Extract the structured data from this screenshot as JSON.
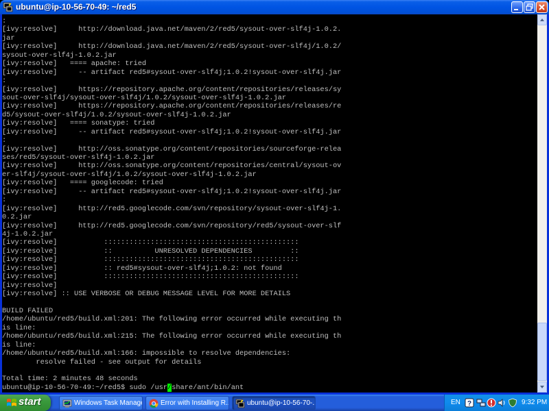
{
  "window": {
    "title": "ubuntu@ip-10-56-70-49: ~/red5",
    "controls": {
      "minimize": "minimize",
      "maximize": "maximize",
      "close": "close"
    }
  },
  "terminal": {
    "lines": [
      ":",
      "[ivy:resolve]     http://download.java.net/maven/2/red5/sysout-over-slf4j-1.0.2.",
      "jar",
      "[ivy:resolve]     http://download.java.net/maven/2/red5/sysout-over-slf4j/1.0.2/",
      "sysout-over-slf4j-1.0.2.jar",
      "[ivy:resolve]   ==== apache: tried",
      "[ivy:resolve]     -- artifact red5#sysout-over-slf4j;1.0.2!sysout-over-slf4j.jar",
      ":",
      "[ivy:resolve]     https://repository.apache.org/content/repositories/releases/sy",
      "sout-over-slf4j/sysout-over-slf4j/1.0.2/sysout-over-slf4j-1.0.2.jar",
      "[ivy:resolve]     https://repository.apache.org/content/repositories/releases/re",
      "d5/sysout-over-slf4j/1.0.2/sysout-over-slf4j-1.0.2.jar",
      "[ivy:resolve]   ==== sonatype: tried",
      "[ivy:resolve]     -- artifact red5#sysout-over-slf4j;1.0.2!sysout-over-slf4j.jar",
      ":",
      "[ivy:resolve]     http://oss.sonatype.org/content/repositories/sourceforge-relea",
      "ses/red5/sysout-over-slf4j-1.0.2.jar",
      "[ivy:resolve]     http://oss.sonatype.org/content/repositories/central/sysout-ov",
      "er-slf4j/sysout-over-slf4j/1.0.2/sysout-over-slf4j-1.0.2.jar",
      "[ivy:resolve]   ==== googlecode: tried",
      "[ivy:resolve]     -- artifact red5#sysout-over-slf4j;1.0.2!sysout-over-slf4j.jar",
      ":",
      "[ivy:resolve]     http://red5.googlecode.com/svn/repository/sysout-over-slf4j-1.",
      "0.2.jar",
      "[ivy:resolve]     http://red5.googlecode.com/svn/repository/red5/sysout-over-slf",
      "4j-1.0.2.jar",
      "[ivy:resolve]           ::::::::::::::::::::::::::::::::::::::::::::::",
      "[ivy:resolve]           ::          UNRESOLVED DEPENDENCIES         ::",
      "[ivy:resolve]           ::::::::::::::::::::::::::::::::::::::::::::::",
      "[ivy:resolve]           :: red5#sysout-over-slf4j;1.0.2: not found",
      "[ivy:resolve]           ::::::::::::::::::::::::::::::::::::::::::::::",
      "[ivy:resolve]",
      "[ivy:resolve] :: USE VERBOSE OR DEBUG MESSAGE LEVEL FOR MORE DETAILS",
      "",
      "BUILD FAILED",
      "/home/ubuntu/red5/build.xml:201: The following error occurred while executing th",
      "is line:",
      "/home/ubuntu/red5/build.xml:215: The following error occurred while executing th",
      "is line:",
      "/home/ubuntu/red5/build.xml:166: impossible to resolve dependencies:",
      "        resolve failed - see output for details",
      "",
      "Total time: 2 minutes 48 seconds"
    ],
    "prompt": {
      "before_cursor": "ubuntu@ip-10-56-70-49:~/red5$ sudo /usr",
      "cursor_char": "/",
      "after_cursor": "share/ant/bin/ant"
    },
    "colors": {
      "background": "#000000",
      "text": "#c0c0c0",
      "cursor": "#00ff00"
    }
  },
  "taskbar": {
    "start_label": "start",
    "tasks": [
      {
        "label": "Windows Task Manager",
        "icon": "task-manager-icon",
        "active": false
      },
      {
        "label": "Error with Installing R...",
        "icon": "chrome-icon",
        "active": false
      },
      {
        "label": "ubuntu@ip-10-56-70-...",
        "icon": "putty-icon",
        "active": true
      }
    ],
    "tray": {
      "language": "EN",
      "icons": [
        "help-icon",
        "network-icon",
        "warning-icon",
        "volume-icon",
        "security-icon"
      ],
      "clock": "9:32 PM"
    }
  }
}
